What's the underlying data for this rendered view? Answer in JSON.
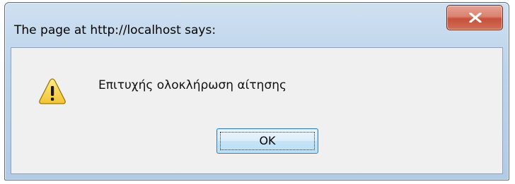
{
  "dialog": {
    "title": "The page at http://localhost says:",
    "message": "Επιτυχής ολοκλήρωση αίτησης",
    "ok_label": "OK",
    "icon": "warning-icon",
    "close_icon": "close-icon"
  },
  "colors": {
    "close_button": "#c7503a",
    "warning_icon": "#f2c531",
    "ok_border": "#3c7fb1"
  }
}
